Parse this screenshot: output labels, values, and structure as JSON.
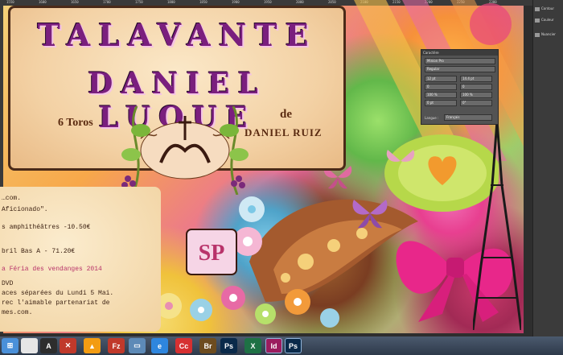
{
  "poster": {
    "title1": "TALAVANTE",
    "title2": "DANIEL LUQUE",
    "toros": "6 Toros",
    "de": "de",
    "ganaderia": "DANIEL RUIZ"
  },
  "info_lines": [
    "…com.",
    "Aficionado\".",
    "s amphithéâtres -10.50€",
    "bril Bas A - 71.20€",
    "a Féria des vendanges 2014",
    "DVD",
    "aces séparées du Lundi 5 Mai.",
    "rec l'aimable partenariat de",
    "mes.com."
  ],
  "logo_text": "SP",
  "character_panel": {
    "title": "Caractère",
    "font": "Minion Pro",
    "style": "Regular",
    "size": "12 pt",
    "leading": "14.4 pt",
    "tracking": "0",
    "scale_v": "100 %",
    "scale_h": "100 %",
    "baseline": "0 pt",
    "skew": "0°",
    "language_label": "Langue :",
    "language": "Français"
  },
  "right_panel": {
    "items": [
      "Contour",
      "Couleur",
      "Nuancier"
    ]
  },
  "taskbar": {
    "apps": [
      {
        "name": "start",
        "label": "⊞",
        "color": "#4a90d9"
      },
      {
        "name": "bridge-app",
        "label": "",
        "color": "#e6e6e6"
      },
      {
        "name": "archive-app",
        "label": "A",
        "color": "#2d2d2d"
      },
      {
        "name": "x-app",
        "label": "✕",
        "color": "#c0392b"
      },
      {
        "name": "vlc",
        "label": "▲",
        "color": "#f39c12"
      },
      {
        "name": "filezilla",
        "label": "Fz",
        "color": "#c0392b"
      },
      {
        "name": "network",
        "label": "▭",
        "color": "#5d8ab7"
      },
      {
        "name": "internet-explorer",
        "label": "e",
        "color": "#2e86de"
      },
      {
        "name": "creative-cloud",
        "label": "Cc",
        "color": "#d63031"
      },
      {
        "name": "adobe-bridge",
        "label": "Br",
        "color": "#6d4c1f"
      },
      {
        "name": "photoshop-1",
        "label": "Ps",
        "color": "#0a2a4a"
      },
      {
        "name": "excel",
        "label": "X",
        "color": "#1e7145"
      },
      {
        "name": "indesign",
        "label": "Id",
        "color": "#9b1c5e"
      },
      {
        "name": "photoshop-2",
        "label": "Ps",
        "color": "#0a2a4a"
      }
    ]
  },
  "ruler_ticks": [
    "1550",
    "1600",
    "1650",
    "1700",
    "1750",
    "1800",
    "1850",
    "1900",
    "1950",
    "2000",
    "2050",
    "2100",
    "2150",
    "2200",
    "2250",
    "2300"
  ]
}
